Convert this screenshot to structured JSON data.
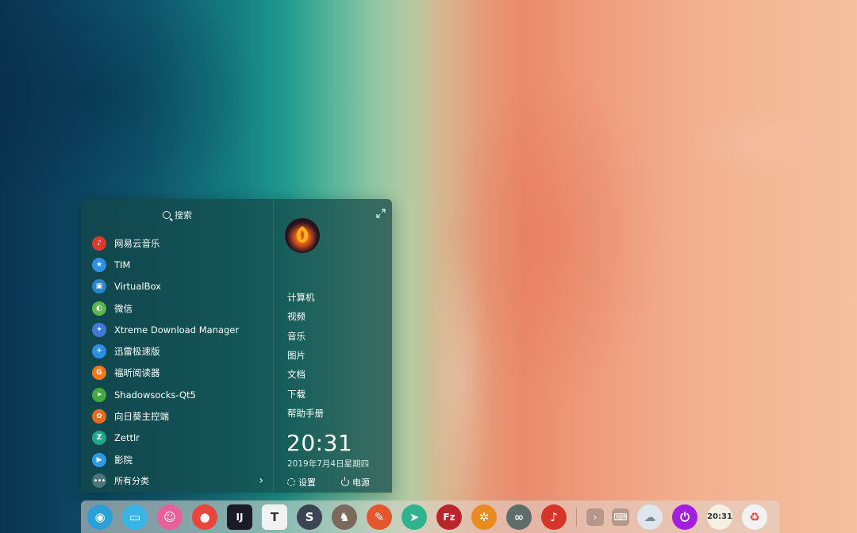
{
  "launcher": {
    "search_label": "搜索",
    "apps": [
      {
        "label": "网易云音乐",
        "icon": "netease-music-icon",
        "color": "#d93b2b",
        "glyph": "♪"
      },
      {
        "label": "TIM",
        "icon": "tim-icon",
        "color": "#2e8fe6",
        "glyph": "★"
      },
      {
        "label": "VirtualBox",
        "icon": "virtualbox-icon",
        "color": "#2b86c9",
        "glyph": "▣"
      },
      {
        "label": "微信",
        "icon": "wechat-icon",
        "color": "#5ab848",
        "glyph": "◐"
      },
      {
        "label": "Xtreme Download Manager",
        "icon": "xdm-icon",
        "color": "#3f7bd6",
        "glyph": "✦"
      },
      {
        "label": "迅雷极速版",
        "icon": "thunder-icon",
        "color": "#2b8ee8",
        "glyph": "✈"
      },
      {
        "label": "福昕阅读器",
        "icon": "foxit-icon",
        "color": "#ee7a1d",
        "glyph": "G"
      },
      {
        "label": "Shadowsocks-Qt5",
        "icon": "shadowsocks-icon",
        "color": "#46a841",
        "glyph": "➤"
      },
      {
        "label": "向日葵主控端",
        "icon": "sunflower-icon",
        "color": "#e36d1c",
        "glyph": "✿"
      },
      {
        "label": "Zettlr",
        "icon": "zettlr-icon",
        "color": "#23a68a",
        "glyph": "Z"
      },
      {
        "label": "影院",
        "icon": "cinema-icon",
        "color": "#2f9ae3",
        "glyph": "▶"
      }
    ],
    "category_label": "所有分类",
    "places": [
      "计算机",
      "视频",
      "音乐",
      "图片",
      "文档",
      "下载",
      "帮助手册"
    ],
    "time": "20:31",
    "date": "2019年7月4日星期四",
    "settings_label": "设置",
    "power_label": "电源"
  },
  "dock": {
    "items": [
      {
        "name": "launcher-icon",
        "color": "#2a9fd8",
        "glyph": "◉",
        "shape": "circle"
      },
      {
        "name": "files-icon",
        "color": "#39b4e6",
        "glyph": "▭",
        "shape": "circle"
      },
      {
        "name": "store-icon",
        "color": "#e8609a",
        "glyph": "☺",
        "shape": "circle"
      },
      {
        "name": "chrome-icon",
        "color": "#e8453c",
        "glyph": "●",
        "shape": "circle"
      },
      {
        "name": "intellij-icon",
        "color": "#1b1b28",
        "glyph": "IJ",
        "shape": "sq"
      },
      {
        "name": "typora-icon",
        "color": "#f2f2f2",
        "glyph": "T",
        "shape": "sq",
        "fg": "#333"
      },
      {
        "name": "sublime-icon",
        "color": "#3a4452",
        "glyph": "S",
        "shape": "circle"
      },
      {
        "name": "gimp-icon",
        "color": "#7a6a5c",
        "glyph": "♞",
        "shape": "circle"
      },
      {
        "name": "editor-icon",
        "color": "#e4572e",
        "glyph": "✎",
        "shape": "circle"
      },
      {
        "name": "telegram-icon",
        "color": "#2fb28e",
        "glyph": "➤",
        "shape": "circle"
      },
      {
        "name": "filezilla-icon",
        "color": "#b8262b",
        "glyph": "Fz",
        "shape": "circle"
      },
      {
        "name": "settings-icon",
        "color": "#e98b1e",
        "glyph": "✲",
        "shape": "circle"
      },
      {
        "name": "arduino-icon",
        "color": "#5f6d6a",
        "glyph": "∞",
        "shape": "circle"
      },
      {
        "name": "netease-music-icon",
        "color": "#d8352a",
        "glyph": "♪",
        "shape": "circle"
      }
    ],
    "tray": [
      {
        "name": "chevron-right-icon",
        "glyph": "›"
      },
      {
        "name": "keyboard-icon",
        "glyph": "⌨"
      }
    ],
    "widgets": [
      {
        "name": "weather-icon",
        "color": "#dfe6ee",
        "glyph": "☁",
        "fg": "#7b8b9a"
      },
      {
        "name": "shutdown-icon",
        "color": "#a31fe0",
        "glyph": "⏻"
      },
      {
        "name": "clock-icon",
        "color": "#f4f0e4",
        "glyph": "20:31",
        "fg": "#333"
      },
      {
        "name": "trash-icon",
        "color": "#f2f2f2",
        "glyph": "♻",
        "fg": "#e0433a"
      }
    ]
  }
}
